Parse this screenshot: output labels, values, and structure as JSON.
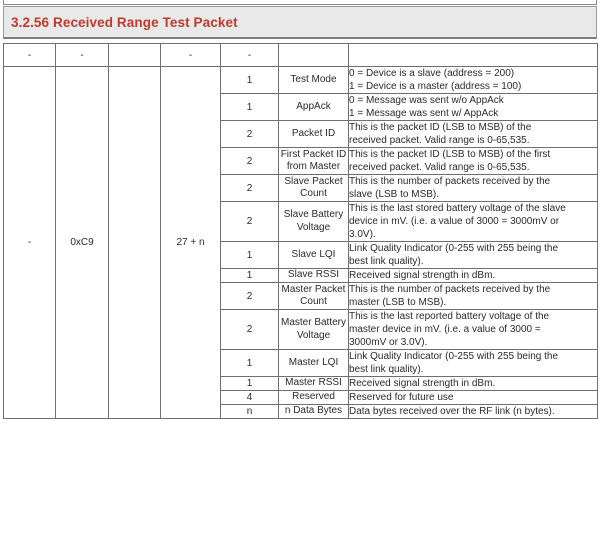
{
  "heading": {
    "number": "3.2.56",
    "title": "Received Range Test Packet",
    "full": "3.2.56 Received Range Test Packet",
    "accent_color": "#c0392b",
    "band_color": "#e9e9e9"
  },
  "table": {
    "header_row": [
      "-",
      "-",
      "",
      "-",
      "-",
      "",
      ""
    ],
    "merged_left": {
      "col1": "-",
      "col2": "0xC9",
      "col3": "",
      "col4": "27 + n"
    },
    "rows": [
      {
        "size": "1",
        "name": "Test Mode",
        "description_lines": [
          "0 = Device is a slave (address = 200)",
          "1 = Device is a master (address = 100)"
        ]
      },
      {
        "size": "1",
        "name": "AppAck",
        "description_lines": [
          "0 = Message was sent w/o AppAck",
          "1 = Message was sent w/ AppAck"
        ]
      },
      {
        "size": "2",
        "name": "Packet ID",
        "description_lines": [
          "This is the packet ID (LSB to MSB) of the",
          "received packet.  Valid range is 0-65,535."
        ]
      },
      {
        "size": "2",
        "name": "First Packet ID from Master",
        "description_lines": [
          "This is the packet ID (LSB to MSB) of the first",
          "received packet.  Valid range is 0-65,535."
        ]
      },
      {
        "size": "2",
        "name": "Slave Packet Count",
        "description_lines": [
          "This is the number of packets received by the",
          "slave (LSB to MSB)."
        ]
      },
      {
        "size": "2",
        "name": "Slave Battery Voltage",
        "description_lines": [
          "This is the last stored battery voltage of the slave",
          "device in mV.  (i.e. a value of 3000 = 3000mV or",
          "3.0V)."
        ]
      },
      {
        "size": "1",
        "name": "Slave LQI",
        "description_lines": [
          "Link Quality Indicator (0-255 with 255 being the",
          "best link quality)."
        ]
      },
      {
        "size": "1",
        "name": "Slave RSSI",
        "description_lines": [
          "Received signal strength in dBm."
        ]
      },
      {
        "size": "2",
        "name": "Master Packet Count",
        "description_lines": [
          "This is the number of packets received by the",
          "master (LSB to MSB)."
        ]
      },
      {
        "size": "2",
        "name": "Master Battery Voltage",
        "description_lines": [
          "This is the last reported battery voltage of the",
          "master device in mV.  (i.e. a value of 3000 =",
          "3000mV or 3.0V)."
        ]
      },
      {
        "size": "1",
        "name": "Master LQI",
        "description_lines": [
          "Link Quality Indicator (0-255 with 255 being the",
          "best link quality)."
        ]
      },
      {
        "size": "1",
        "name": "Master RSSI",
        "description_lines": [
          "Received signal strength in dBm."
        ]
      },
      {
        "size": "4",
        "name": "Reserved",
        "description_lines": [
          "Reserved for future use"
        ]
      },
      {
        "size": "n",
        "name": "n Data Bytes",
        "description_lines": [
          "Data bytes received over the RF link (n bytes)."
        ]
      }
    ]
  }
}
